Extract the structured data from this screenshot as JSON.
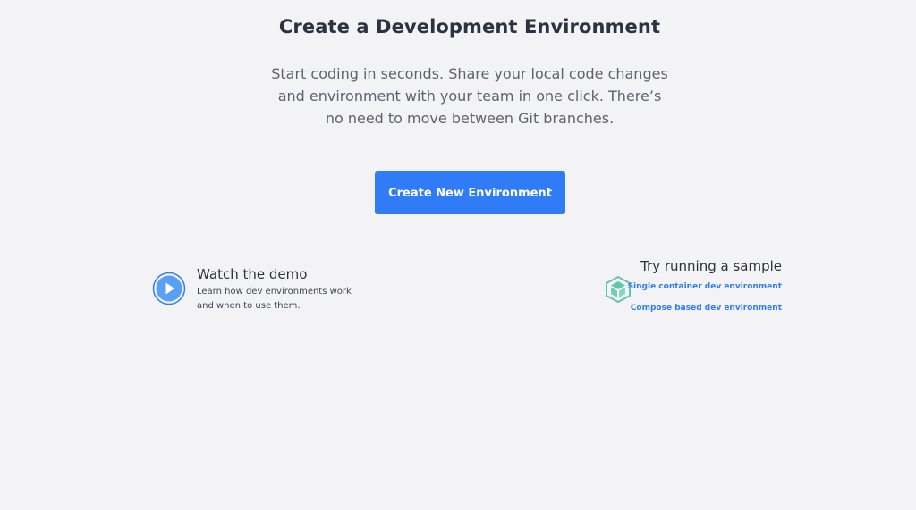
{
  "heading": {
    "title": "Create a Development Environment",
    "subtitle": "Start coding in seconds. Share your local code changes and environment with your team in one click. There’s no need to move between Git branches."
  },
  "actions": {
    "create_label": "Create New Environment"
  },
  "demo": {
    "icon": "play-icon",
    "title": "Watch the demo",
    "description": "Learn how dev environments work and when to use them."
  },
  "sample": {
    "icon": "cube-icon",
    "title": "Try running a sample",
    "links": [
      {
        "label": "Single container dev environment"
      },
      {
        "label": "Compose based dev environment"
      }
    ]
  },
  "colors": {
    "background": "#f3f3f6",
    "accent": "#2f7cf6",
    "cube": "#5ec8a8",
    "text": "#2b3240"
  }
}
